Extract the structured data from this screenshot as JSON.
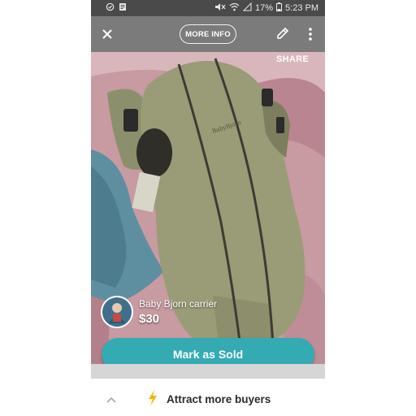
{
  "status_bar": {
    "battery_percent": "17%",
    "time": "5:23 PM",
    "icons": [
      "alarm-icon",
      "image-icon",
      "mute-icon",
      "wifi-icon",
      "signal-icon",
      "battery-icon"
    ]
  },
  "top_bar": {
    "close_icon": "close-icon",
    "more_info_label": "MORE INFO",
    "edit_icon": "pencil-icon",
    "menu_icon": "more-vert-icon"
  },
  "listing": {
    "share_label": "SHARE",
    "title": "Baby Bjorn carrier",
    "price": "$30",
    "mark_sold_label": "Mark as Sold"
  },
  "bottom_bar": {
    "attract_label": "Attract more buyers",
    "bolt_color": "#f5b400"
  },
  "colors": {
    "accent": "#34aab3",
    "top_bar": "#7b7b7b",
    "status_bar": "#4a4a4a"
  }
}
